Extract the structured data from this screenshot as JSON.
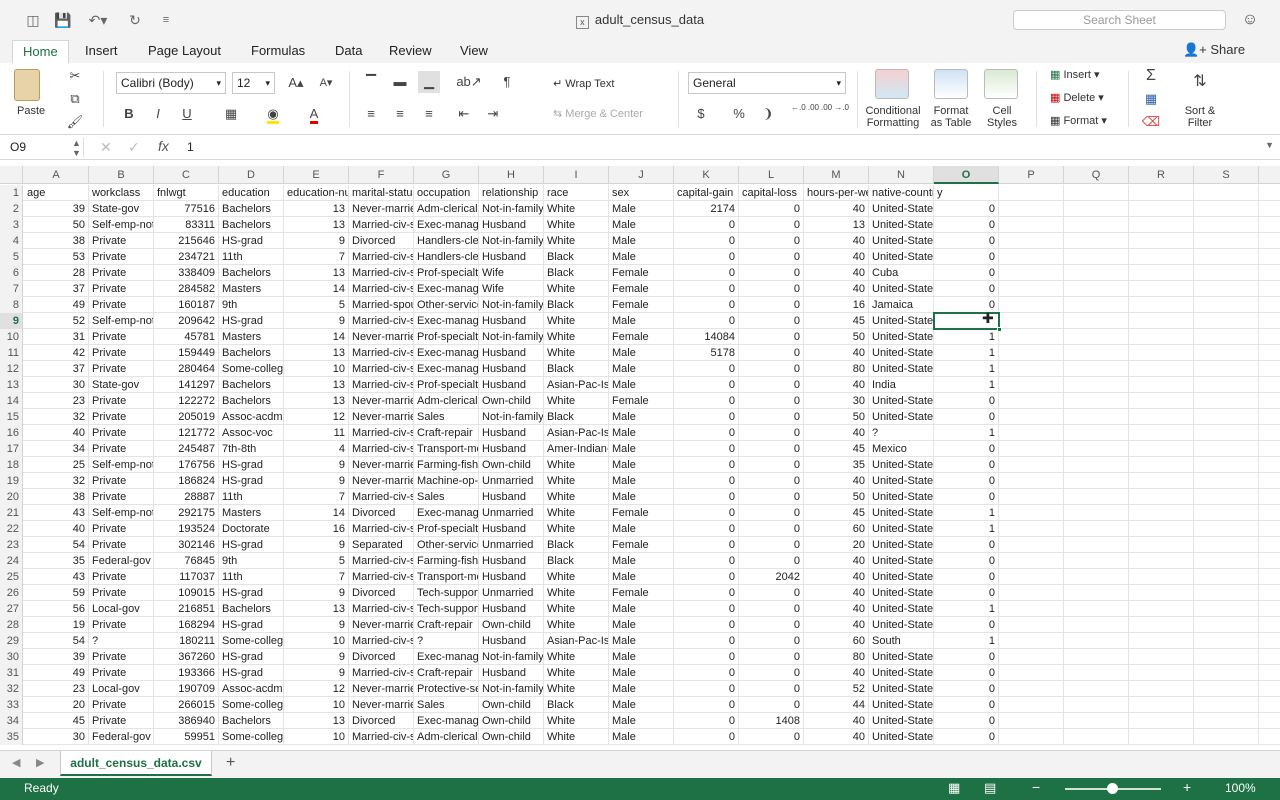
{
  "window": {
    "title": "adult_census_data",
    "search_placeholder": "Search Sheet"
  },
  "tabs": [
    "Home",
    "Insert",
    "Page Layout",
    "Formulas",
    "Data",
    "Review",
    "View"
  ],
  "share_label": "Share",
  "ribbon": {
    "paste": "Paste",
    "font_name": "Calibri (Body)",
    "font_size": "12",
    "bold": "B",
    "italic": "I",
    "underline": "U",
    "wrap_text": "Wrap Text",
    "merge_center": "Merge & Center",
    "number_format": "General",
    "currency": "$",
    "percent": "%",
    "comma": "❩",
    "inc_decimal": "←.0 .00",
    "dec_decimal": ".00 →.0",
    "conditional": [
      "Conditional",
      "Formatting"
    ],
    "format_table": [
      "Format",
      "as Table"
    ],
    "cell_styles": [
      "Cell",
      "Styles"
    ],
    "insert": "Insert",
    "delete": "Delete",
    "format": "Format",
    "sort_filter": [
      "Sort &",
      "Filter"
    ]
  },
  "formula_bar": {
    "name_box": "O9",
    "formula": "1"
  },
  "columns": [
    "A",
    "B",
    "C",
    "D",
    "E",
    "F",
    "G",
    "H",
    "I",
    "J",
    "K",
    "L",
    "M",
    "N",
    "O",
    "P",
    "Q",
    "R",
    "S"
  ],
  "headers": [
    "age",
    "workclass",
    "fnlwgt",
    "education",
    "education-num",
    "marital-status",
    "occupation",
    "relationship",
    "race",
    "sex",
    "capital-gain",
    "capital-loss",
    "hours-per-week",
    "native-country",
    "y"
  ],
  "rows": [
    [
      "39",
      "State-gov",
      "77516",
      "Bachelors",
      "13",
      "Never-married",
      "Adm-clerical",
      "Not-in-family",
      "White",
      "Male",
      "2174",
      "0",
      "40",
      "United-States",
      "0"
    ],
    [
      "50",
      "Self-emp-not-inc",
      "83311",
      "Bachelors",
      "13",
      "Married-civ-spouse",
      "Exec-managerial",
      "Husband",
      "White",
      "Male",
      "0",
      "0",
      "13",
      "United-States",
      "0"
    ],
    [
      "38",
      "Private",
      "215646",
      "HS-grad",
      "9",
      "Divorced",
      "Handlers-cleaners",
      "Not-in-family",
      "White",
      "Male",
      "0",
      "0",
      "40",
      "United-States",
      "0"
    ],
    [
      "53",
      "Private",
      "234721",
      "11th",
      "7",
      "Married-civ-spouse",
      "Handlers-cleaners",
      "Husband",
      "Black",
      "Male",
      "0",
      "0",
      "40",
      "United-States",
      "0"
    ],
    [
      "28",
      "Private",
      "338409",
      "Bachelors",
      "13",
      "Married-civ-spouse",
      "Prof-specialty",
      "Wife",
      "Black",
      "Female",
      "0",
      "0",
      "40",
      "Cuba",
      "0"
    ],
    [
      "37",
      "Private",
      "284582",
      "Masters",
      "14",
      "Married-civ-spouse",
      "Exec-managerial",
      "Wife",
      "White",
      "Female",
      "0",
      "0",
      "40",
      "United-States",
      "0"
    ],
    [
      "49",
      "Private",
      "160187",
      "9th",
      "5",
      "Married-spouse-absent",
      "Other-service",
      "Not-in-family",
      "Black",
      "Female",
      "0",
      "0",
      "16",
      "Jamaica",
      "0"
    ],
    [
      "52",
      "Self-emp-not-inc",
      "209642",
      "HS-grad",
      "9",
      "Married-civ-spouse",
      "Exec-managerial",
      "Husband",
      "White",
      "Male",
      "0",
      "0",
      "45",
      "United-States",
      ""
    ],
    [
      "31",
      "Private",
      "45781",
      "Masters",
      "14",
      "Never-married",
      "Prof-specialty",
      "Not-in-family",
      "White",
      "Female",
      "14084",
      "0",
      "50",
      "United-States",
      "1"
    ],
    [
      "42",
      "Private",
      "159449",
      "Bachelors",
      "13",
      "Married-civ-spouse",
      "Exec-managerial",
      "Husband",
      "White",
      "Male",
      "5178",
      "0",
      "40",
      "United-States",
      "1"
    ],
    [
      "37",
      "Private",
      "280464",
      "Some-college",
      "10",
      "Married-civ-spouse",
      "Exec-managerial",
      "Husband",
      "Black",
      "Male",
      "0",
      "0",
      "80",
      "United-States",
      "1"
    ],
    [
      "30",
      "State-gov",
      "141297",
      "Bachelors",
      "13",
      "Married-civ-spouse",
      "Prof-specialty",
      "Husband",
      "Asian-Pac-Islander",
      "Male",
      "0",
      "0",
      "40",
      "India",
      "1"
    ],
    [
      "23",
      "Private",
      "122272",
      "Bachelors",
      "13",
      "Never-married",
      "Adm-clerical",
      "Own-child",
      "White",
      "Female",
      "0",
      "0",
      "30",
      "United-States",
      "0"
    ],
    [
      "32",
      "Private",
      "205019",
      "Assoc-acdm",
      "12",
      "Never-married",
      "Sales",
      "Not-in-family",
      "Black",
      "Male",
      "0",
      "0",
      "50",
      "United-States",
      "0"
    ],
    [
      "40",
      "Private",
      "121772",
      "Assoc-voc",
      "11",
      "Married-civ-spouse",
      "Craft-repair",
      "Husband",
      "Asian-Pac-Islander",
      "Male",
      "0",
      "0",
      "40",
      "?",
      "1"
    ],
    [
      "34",
      "Private",
      "245487",
      "7th-8th",
      "4",
      "Married-civ-spouse",
      "Transport-moving",
      "Husband",
      "Amer-Indian-Eskimo",
      "Male",
      "0",
      "0",
      "45",
      "Mexico",
      "0"
    ],
    [
      "25",
      "Self-emp-not-inc",
      "176756",
      "HS-grad",
      "9",
      "Never-married",
      "Farming-fishing",
      "Own-child",
      "White",
      "Male",
      "0",
      "0",
      "35",
      "United-States",
      "0"
    ],
    [
      "32",
      "Private",
      "186824",
      "HS-grad",
      "9",
      "Never-married",
      "Machine-op-inspct",
      "Unmarried",
      "White",
      "Male",
      "0",
      "0",
      "40",
      "United-States",
      "0"
    ],
    [
      "38",
      "Private",
      "28887",
      "11th",
      "7",
      "Married-civ-spouse",
      "Sales",
      "Husband",
      "White",
      "Male",
      "0",
      "0",
      "50",
      "United-States",
      "0"
    ],
    [
      "43",
      "Self-emp-not-inc",
      "292175",
      "Masters",
      "14",
      "Divorced",
      "Exec-managerial",
      "Unmarried",
      "White",
      "Female",
      "0",
      "0",
      "45",
      "United-States",
      "1"
    ],
    [
      "40",
      "Private",
      "193524",
      "Doctorate",
      "16",
      "Married-civ-spouse",
      "Prof-specialty",
      "Husband",
      "White",
      "Male",
      "0",
      "0",
      "60",
      "United-States",
      "1"
    ],
    [
      "54",
      "Private",
      "302146",
      "HS-grad",
      "9",
      "Separated",
      "Other-service",
      "Unmarried",
      "Black",
      "Female",
      "0",
      "0",
      "20",
      "United-States",
      "0"
    ],
    [
      "35",
      "Federal-gov",
      "76845",
      "9th",
      "5",
      "Married-civ-spouse",
      "Farming-fishing",
      "Husband",
      "Black",
      "Male",
      "0",
      "0",
      "40",
      "United-States",
      "0"
    ],
    [
      "43",
      "Private",
      "117037",
      "11th",
      "7",
      "Married-civ-spouse",
      "Transport-moving",
      "Husband",
      "White",
      "Male",
      "0",
      "2042",
      "40",
      "United-States",
      "0"
    ],
    [
      "59",
      "Private",
      "109015",
      "HS-grad",
      "9",
      "Divorced",
      "Tech-support",
      "Unmarried",
      "White",
      "Female",
      "0",
      "0",
      "40",
      "United-States",
      "0"
    ],
    [
      "56",
      "Local-gov",
      "216851",
      "Bachelors",
      "13",
      "Married-civ-spouse",
      "Tech-support",
      "Husband",
      "White",
      "Male",
      "0",
      "0",
      "40",
      "United-States",
      "1"
    ],
    [
      "19",
      "Private",
      "168294",
      "HS-grad",
      "9",
      "Never-married",
      "Craft-repair",
      "Own-child",
      "White",
      "Male",
      "0",
      "0",
      "40",
      "United-States",
      "0"
    ],
    [
      "54",
      "?",
      "180211",
      "Some-college",
      "10",
      "Married-civ-spouse",
      "?",
      "Husband",
      "Asian-Pac-Islander",
      "Male",
      "0",
      "0",
      "60",
      "South",
      "1"
    ],
    [
      "39",
      "Private",
      "367260",
      "HS-grad",
      "9",
      "Divorced",
      "Exec-managerial",
      "Not-in-family",
      "White",
      "Male",
      "0",
      "0",
      "80",
      "United-States",
      "0"
    ],
    [
      "49",
      "Private",
      "193366",
      "HS-grad",
      "9",
      "Married-civ-spouse",
      "Craft-repair",
      "Husband",
      "White",
      "Male",
      "0",
      "0",
      "40",
      "United-States",
      "0"
    ],
    [
      "23",
      "Local-gov",
      "190709",
      "Assoc-acdm",
      "12",
      "Never-married",
      "Protective-serv",
      "Not-in-family",
      "White",
      "Male",
      "0",
      "0",
      "52",
      "United-States",
      "0"
    ],
    [
      "20",
      "Private",
      "266015",
      "Some-college",
      "10",
      "Never-married",
      "Sales",
      "Own-child",
      "Black",
      "Male",
      "0",
      "0",
      "44",
      "United-States",
      "0"
    ],
    [
      "45",
      "Private",
      "386940",
      "Bachelors",
      "13",
      "Divorced",
      "Exec-managerial",
      "Own-child",
      "White",
      "Male",
      "0",
      "1408",
      "40",
      "United-States",
      "0"
    ],
    [
      "30",
      "Federal-gov",
      "59951",
      "Some-college",
      "10",
      "Married-civ-spouse",
      "Adm-clerical",
      "Own-child",
      "White",
      "Male",
      "0",
      "0",
      "40",
      "United-States",
      "0"
    ]
  ],
  "selected": {
    "col": "O",
    "row": 9
  },
  "sheet_tab": "adult_census_data.csv",
  "status": "Ready",
  "zoom": "100%",
  "colors": {
    "accent": "#1e7145"
  }
}
